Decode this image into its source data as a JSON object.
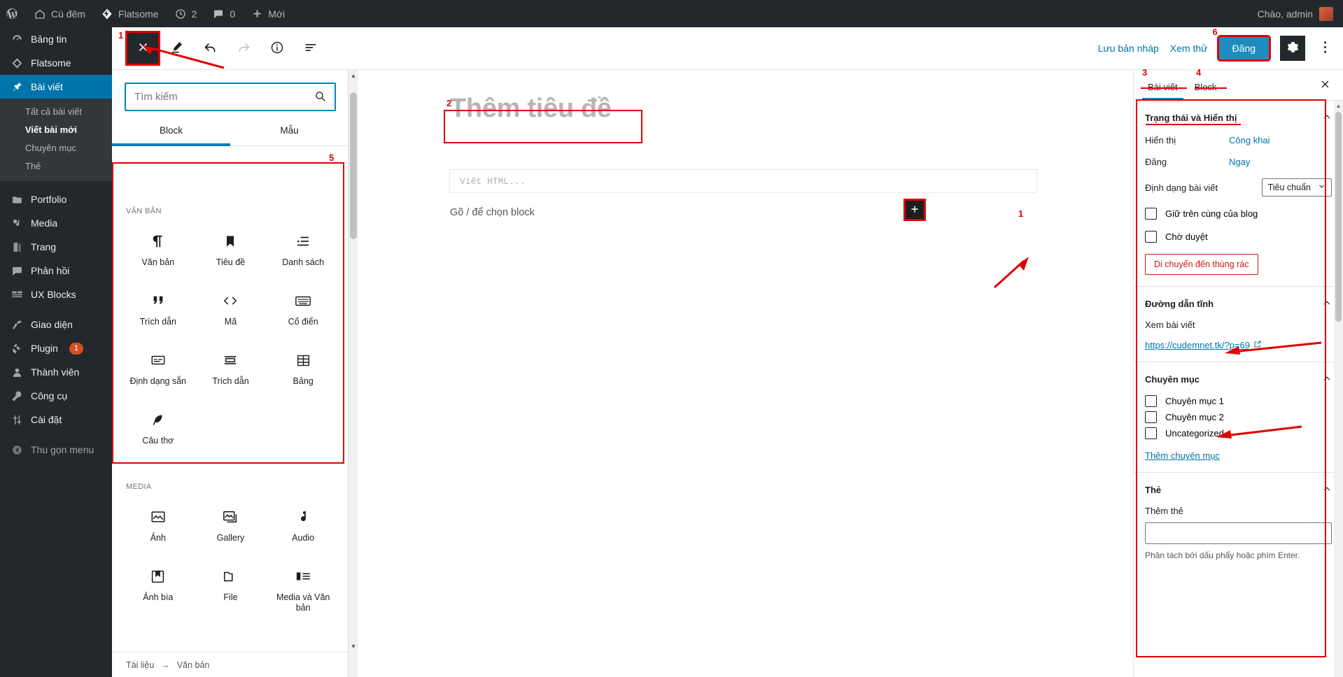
{
  "adminbar": {
    "site_name": "Cú đêm",
    "theme_name": "Flatsome",
    "updates_count": "2",
    "comments_count": "0",
    "new_label": "Mới",
    "greeting": "Chào, admin"
  },
  "adminmenu": {
    "items": [
      {
        "label": "Bảng tin",
        "icon": "dashboard-icon"
      },
      {
        "label": "Flatsome",
        "icon": "flatsome-icon"
      },
      {
        "label": "Bài viết",
        "icon": "pin-icon",
        "current": true
      },
      {
        "label": "Portfolio",
        "icon": "portfolio-icon"
      },
      {
        "label": "Media",
        "icon": "media-icon"
      },
      {
        "label": "Trang",
        "icon": "page-icon"
      },
      {
        "label": "Phản hồi",
        "icon": "comment-icon"
      },
      {
        "label": "UX Blocks",
        "icon": "blocks-icon"
      },
      {
        "label": "Giao diện",
        "icon": "appearance-icon"
      },
      {
        "label": "Plugin",
        "icon": "plugin-icon",
        "badge": "1"
      },
      {
        "label": "Thành viên",
        "icon": "user-icon"
      },
      {
        "label": "Công cụ",
        "icon": "tools-icon"
      },
      {
        "label": "Cài đặt",
        "icon": "settings-icon"
      }
    ],
    "submenu": [
      {
        "label": "Tất cả bài viết"
      },
      {
        "label": "Viết bài mới",
        "active": true
      },
      {
        "label": "Chuyên mục"
      },
      {
        "label": "Thẻ"
      }
    ],
    "collapse_label": "Thu gọn menu"
  },
  "editor_header": {
    "tools": [
      {
        "name": "close-inserter-button",
        "icon": "close-x-icon"
      },
      {
        "name": "edit-tool-button",
        "icon": "pencil-icon"
      },
      {
        "name": "undo-button",
        "icon": "undo-arrow-icon"
      },
      {
        "name": "redo-button",
        "icon": "redo-arrow-icon"
      },
      {
        "name": "details-button",
        "icon": "info-circle-icon"
      },
      {
        "name": "list-view-button",
        "icon": "list-view-icon"
      }
    ],
    "save_draft": "Lưu bản nháp",
    "preview": "Xem thử",
    "publish": "Đăng",
    "settings_icon": "gear-icon",
    "more_icon": "vertical-dots-icon"
  },
  "inserter": {
    "search_placeholder": "Tìm kiếm",
    "search_value": "",
    "search_icon": "search-icon",
    "tabs": [
      {
        "label": "Block",
        "active": true
      },
      {
        "label": "Mẫu",
        "active": false
      }
    ],
    "sections": [
      {
        "title": "VĂN BẢN",
        "blocks": [
          {
            "label": "Văn bản",
            "icon": "paragraph-icon"
          },
          {
            "label": "Tiêu đề",
            "icon": "heading-bookmark-icon"
          },
          {
            "label": "Danh sách",
            "icon": "list-icon"
          },
          {
            "label": "Trích dẫn",
            "icon": "quote-icon"
          },
          {
            "label": "Mã",
            "icon": "code-icon"
          },
          {
            "label": "Cổ điển",
            "icon": "classic-keyboard-icon"
          },
          {
            "label": "Định dạng sẵn",
            "icon": "preformatted-icon"
          },
          {
            "label": "Trích dẫn",
            "icon": "pullquote-icon"
          },
          {
            "label": "Bảng",
            "icon": "table-icon"
          },
          {
            "label": "Câu thơ",
            "icon": "verse-feather-icon"
          }
        ]
      },
      {
        "title": "MEDIA",
        "blocks": [
          {
            "label": "Ảnh",
            "icon": "image-icon"
          },
          {
            "label": "Gallery",
            "icon": "gallery-icon"
          },
          {
            "label": "Audio",
            "icon": "audio-note-icon"
          },
          {
            "label": "Ảnh bìa",
            "icon": "cover-icon"
          },
          {
            "label": "File",
            "icon": "file-folder-icon"
          },
          {
            "label": "Media và Văn bản",
            "icon": "media-text-icon"
          }
        ]
      }
    ],
    "footer": {
      "doc_label": "Tài liệu",
      "arrow": "→",
      "block_label": "Văn bản"
    }
  },
  "canvas": {
    "title_placeholder": "Thêm tiêu đề",
    "html_block_placeholder": "Viết HTML...",
    "type_hint": "Gõ / để chọn block",
    "add_block_icon": "plus-icon"
  },
  "settings": {
    "tabs": [
      {
        "label": "Bài viết",
        "active": true
      },
      {
        "label": "Block",
        "active": false
      }
    ],
    "close_icon": "close-x-icon",
    "status_panel": {
      "title": "Trạng thái và Hiển thị",
      "visibility_label": "Hiển thị",
      "visibility_value": "Công khai",
      "publish_label": "Đăng",
      "publish_value": "Ngay",
      "format_label": "Định dạng bài viết",
      "format_value": "Tiêu chuẩn",
      "sticky_label": "Giữ trên cùng của blog",
      "pending_label": "Chờ duyệt",
      "trash_label": "Di chuyển đến thùng rác"
    },
    "permalink_panel": {
      "title": "Đường dẫn tĩnh",
      "view_post_label": "Xem bài viết",
      "url": "https://cudemnet.tk/?p=69",
      "external_icon": "external-link-icon"
    },
    "categories_panel": {
      "title": "Chuyên mục",
      "items": [
        {
          "label": "Chuyên mục 1",
          "checked": false
        },
        {
          "label": "Chuyên mục 2",
          "checked": false
        },
        {
          "label": "Uncategorized",
          "checked": false
        }
      ],
      "add_link": "Thêm chuyên mục"
    },
    "tags_panel": {
      "title": "Thẻ",
      "add_label": "Thêm thẻ",
      "input_value": "",
      "helper": "Phân tách bởi dấu phẩy hoặc phím Enter."
    }
  },
  "annotations": {
    "markers": [
      "1",
      "2",
      "3",
      "4",
      "5",
      "6",
      "1"
    ],
    "color": "#e00000"
  }
}
